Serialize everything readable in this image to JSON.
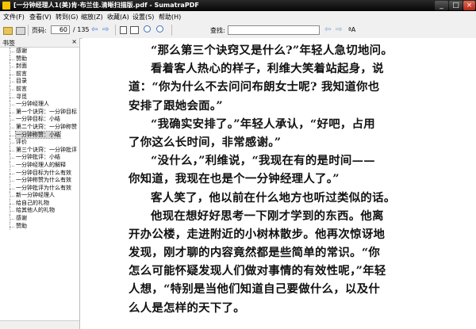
{
  "window": {
    "title": "[一分钟经理人1(美)肯·布兰佳.清晰扫描版.pdf - SumatraPDF",
    "controls": {
      "minimize": "_",
      "maximize": "□",
      "close": "×"
    }
  },
  "menu": [
    "文件(F)",
    "查看(V)",
    "转到(G)",
    "缩放(Z)",
    "收藏(A)",
    "设置(S)",
    "帮助(H)"
  ],
  "toolbar": {
    "page_label": "页码:",
    "page_value": "60",
    "page_total": "/ 135",
    "find_label": "查找:",
    "search_value": "",
    "match_case_label": "ªA",
    "icons": [
      "open-icon",
      "print-icon",
      "prev-page-icon",
      "next-page-icon",
      "fit-page-icon",
      "fit-width-icon",
      "zoom-out-icon",
      "zoom-in-icon",
      "find-prev-icon",
      "find-next-icon"
    ]
  },
  "sidebar": {
    "title": "书签",
    "close": "×",
    "items": [
      "感谢",
      "赞助",
      "封面",
      "前言",
      "目录",
      "前言",
      "寻觅",
      "一分钟经理人",
      "第一个诀窍：一分钟目标",
      "一分钟目标：小结",
      "第二个诀窍：一分钟称赞",
      "一分钟称赞：小结",
      "评价",
      "第三个诀窍：一分钟批评",
      "一分钟批评：小结",
      "一分钟经理人的解释",
      "一分钟目标为什么有效",
      "一分钟称赞为什么有效",
      "一分钟批评为什么有效",
      "新一分钟经理人",
      "给自己的礼物",
      "给其他人的礼物",
      "感谢",
      "赞助"
    ],
    "selected_index": 11
  },
  "page": {
    "lines": [
      "“那么第三个诀窍又是什么?”年轻人急切地问。",
      "看着客人热心的样子，利维大笑着站起身，说",
      "道：“你为什么不去问问布朗女士呢? 我知道你也",
      "安排了跟她会面。”",
      "“我确实安排了。”年轻人承认，“好吧，占用",
      "了你这么长时间，非常感谢。”",
      "“没什么，”利维说，“我现在有的是时间——",
      "你知道，我现在也是个一分钟经理人了。”",
      "客人笑了，他以前在什么地方也听过类似的话。",
      "他现在想好好思考一下刚才学到的东西。他离",
      "开办公楼，走进附近的小树林散步。他再次惊讶地",
      "发现，刚才聊的内容竟然都是些简单的常识。“你",
      "怎么可能怀疑发现人们做对事情的有效性呢，”年轻",
      "人想，“特别是当他们知道自己要做什么，以及什",
      "么人是怎样的天下了。"
    ],
    "indented": [
      true,
      true,
      false,
      false,
      true,
      false,
      true,
      false,
      true,
      true,
      false,
      false,
      false,
      false,
      false
    ]
  }
}
